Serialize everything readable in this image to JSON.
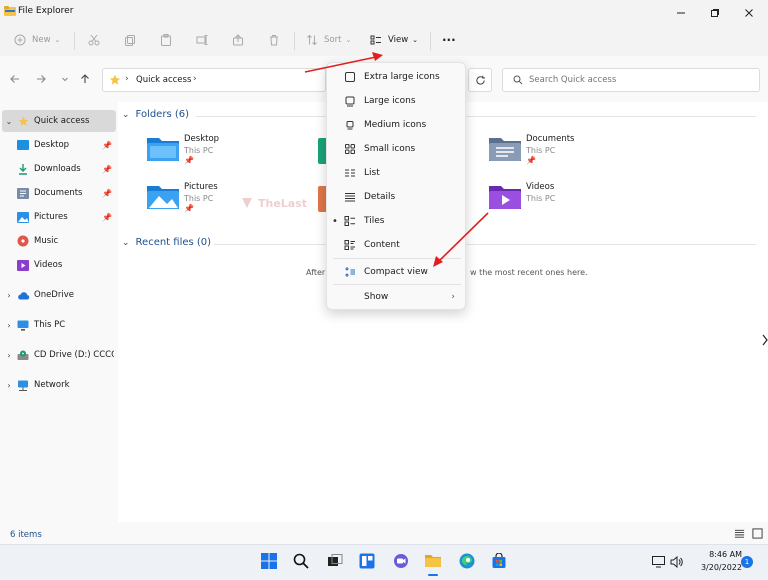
{
  "window": {
    "title": "File Explorer"
  },
  "commandbar": {
    "new_label": "New",
    "sort_label": "Sort",
    "view_label": "View",
    "more_label": "···"
  },
  "address": {
    "crumb": "Quick access",
    "search_placeholder": "Search Quick access"
  },
  "sidebar": {
    "quick_access": "Quick access",
    "pinned": [
      {
        "label": "Desktop"
      },
      {
        "label": "Downloads"
      },
      {
        "label": "Documents"
      },
      {
        "label": "Pictures"
      },
      {
        "label": "Music"
      },
      {
        "label": "Videos"
      }
    ],
    "onedrive": "OneDrive",
    "thispc": "This PC",
    "cddrive": "CD Drive (D:) CCCO",
    "network": "Network"
  },
  "main": {
    "folders_heading": "Folders (6)",
    "folders": [
      {
        "name": "Desktop",
        "sub": "This PC"
      },
      {
        "name": "Documents",
        "sub": "This PC"
      },
      {
        "name": "Pictures",
        "sub": "This PC"
      },
      {
        "name": "Videos",
        "sub": "This PC"
      }
    ],
    "recent_heading": "Recent files (0)",
    "empty_left": "After",
    "empty_right": "w the most recent ones here."
  },
  "view_menu": {
    "items": [
      {
        "label": "Extra large icons"
      },
      {
        "label": "Large icons"
      },
      {
        "label": "Medium icons"
      },
      {
        "label": "Small icons"
      },
      {
        "label": "List"
      },
      {
        "label": "Details"
      },
      {
        "label": "Tiles"
      },
      {
        "label": "Content"
      },
      {
        "label": "Compact view"
      },
      {
        "label": "Show"
      }
    ]
  },
  "watermark": "TheLast",
  "status": {
    "count": "6 items"
  },
  "clock": {
    "time": "8:46 AM",
    "date": "3/20/2022"
  },
  "notifications": "1",
  "colors": {
    "accent": "#1a73e8",
    "folder": "#f6c343",
    "arrow": "#e02020"
  }
}
